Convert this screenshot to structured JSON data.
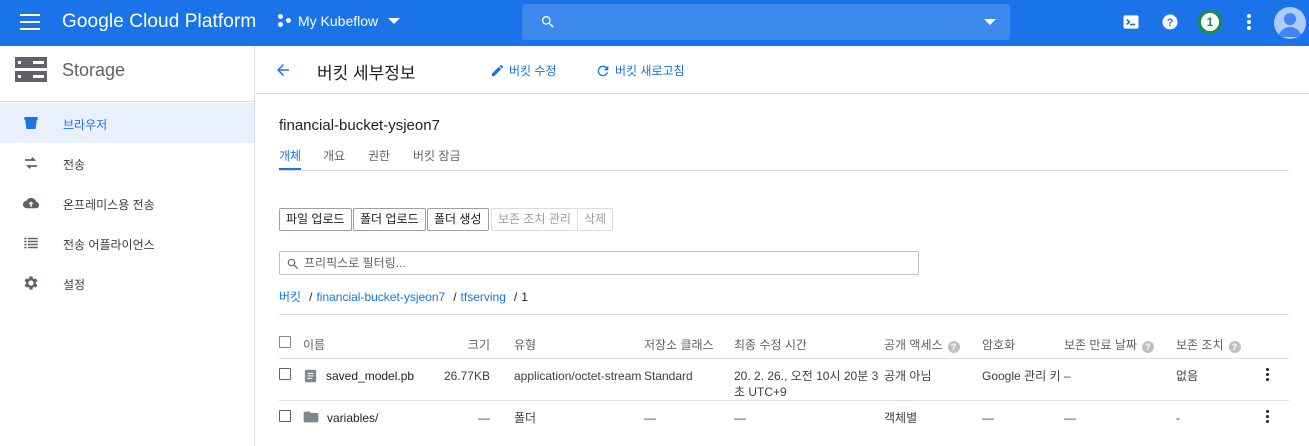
{
  "topbar": {
    "brand": "Google Cloud Platform",
    "project": "My Kubeflow",
    "search_placeholder": "",
    "notification_count": "1",
    "icons": [
      "menu-icon",
      "project-icon",
      "search-icon",
      "cloud-shell-icon",
      "help-icon",
      "more-vert-icon",
      "account-avatar-icon"
    ]
  },
  "sidebar": {
    "title": "Storage",
    "items": [
      {
        "label": "브라우저",
        "icon": "bucket-icon",
        "active": true
      },
      {
        "label": "전송",
        "icon": "transfer-icon",
        "active": false
      },
      {
        "label": "온프레미스용 전송",
        "icon": "cloud-upload-icon",
        "active": false
      },
      {
        "label": "전송 어플라이언스",
        "icon": "appliance-list-icon",
        "active": false
      },
      {
        "label": "설정",
        "icon": "gear-icon",
        "active": false
      }
    ]
  },
  "header": {
    "title": "버킷 세부정보",
    "edit_label": "버킷 수정",
    "refresh_label": "버킷 새로고침"
  },
  "bucket": {
    "name": "financial-bucket-ysjeon7",
    "tabs": [
      "개체",
      "개요",
      "권한",
      "버킷 잠금"
    ],
    "active_tab": 0
  },
  "toolbar": {
    "upload_files": "파일 업로드",
    "upload_folder": "폴더 업로드",
    "create_folder": "폴더 생성",
    "manage_holds": "보존 조치 관리",
    "delete": "삭제"
  },
  "filter": {
    "placeholder": "프리픽스로 필터링..."
  },
  "breadcrumb": {
    "root": "버킷",
    "bucket": "financial-bucket-ysjeon7",
    "folder": "tfserving",
    "current": "1",
    "separator": "/"
  },
  "table": {
    "columns": [
      "이름",
      "크기",
      "유형",
      "저장소 클래스",
      "최종 수정 시간",
      "공개 액세스",
      "암호화",
      "보존 만료 날짜",
      "보존 조치"
    ],
    "help_columns": [
      "공개 액세스",
      "보존 만료 날짜",
      "보존 조치"
    ],
    "rows": [
      {
        "icon": "file-icon",
        "name": "saved_model.pb",
        "size": "26.77KB",
        "type": "application/octet-stream",
        "storage_class": "Standard",
        "modified": "20. 2. 26., 오전 10시 20분 3초 UTC+9",
        "public_access": "공개 아님",
        "encryption": "Google 관리 키",
        "retention_expiry": "–",
        "hold": "없음"
      },
      {
        "icon": "folder-icon",
        "name": "variables/",
        "size": "—",
        "type": "폴더",
        "storage_class": "—",
        "modified": "—",
        "public_access": "객체별",
        "encryption": "—",
        "retention_expiry": "—",
        "hold": "-"
      }
    ]
  },
  "colors": {
    "brand_blue": "#1a73e8",
    "search_bg": "#3d88ec",
    "active_nav_bg": "#e8f0fe",
    "badge_green": "#1e8e3e"
  }
}
